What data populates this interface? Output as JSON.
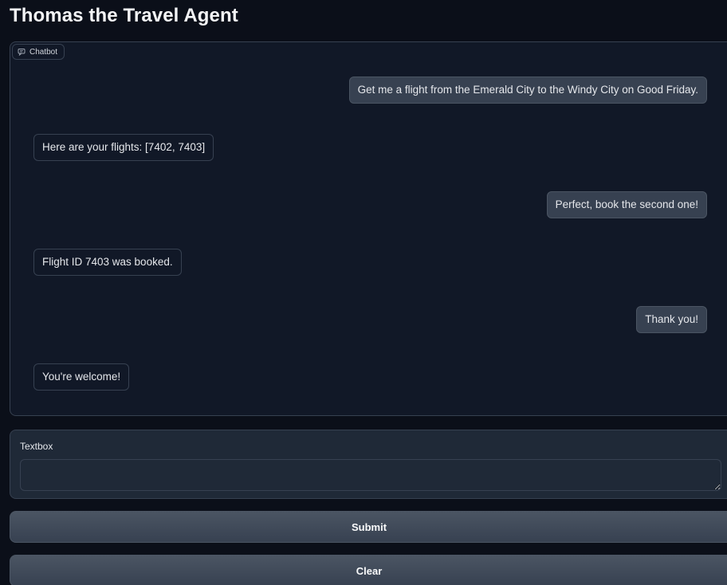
{
  "title": "Thomas the Travel Agent",
  "chatbot": {
    "label": "Chatbot",
    "messages": [
      {
        "role": "user",
        "text": "Get me a flight from the Emerald City to the Windy City on Good Friday."
      },
      {
        "role": "bot",
        "text": "Here are your flights: [7402, 7403]"
      },
      {
        "role": "user",
        "text": "Perfect, book the second one!"
      },
      {
        "role": "bot",
        "text": "Flight ID 7403 was booked."
      },
      {
        "role": "user",
        "text": "Thank you!"
      },
      {
        "role": "bot",
        "text": "You're welcome!"
      }
    ]
  },
  "textbox": {
    "label": "Textbox",
    "value": ""
  },
  "buttons": {
    "submit": "Submit",
    "clear": "Clear"
  },
  "colors": {
    "background": "#0b0f19",
    "panel": "#111827",
    "border": "#374151",
    "user_bubble": "#374151",
    "text": "#e5e7eb"
  }
}
